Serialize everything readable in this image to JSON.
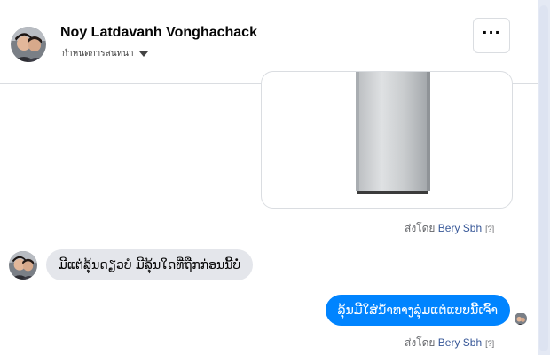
{
  "header": {
    "name": "Noy Latdavanh Vonghachack",
    "subtitle": "กำหนดการสนทนา",
    "more_label": "···"
  },
  "messages": {
    "sent_by_1": {
      "prefix": "ส่งโดย ",
      "name": "Bery Sbh",
      "help": "[?]"
    },
    "incoming_text": "ມີແຕ່ລຸ້ນດຽວບໍ ມີລຸ້ນໃດທີ່ຖືກກ່ອນນີ້ບໍ່",
    "outgoing_text": "ລຸ້ນມີໃສ່ນໍ້າທາງລຸ່ມແຕ່ແບບນີ້ເຈົ້າ",
    "sent_by_2": {
      "prefix": "ส่งโดย ",
      "name": "Bery Sbh",
      "help": "[?]"
    }
  }
}
